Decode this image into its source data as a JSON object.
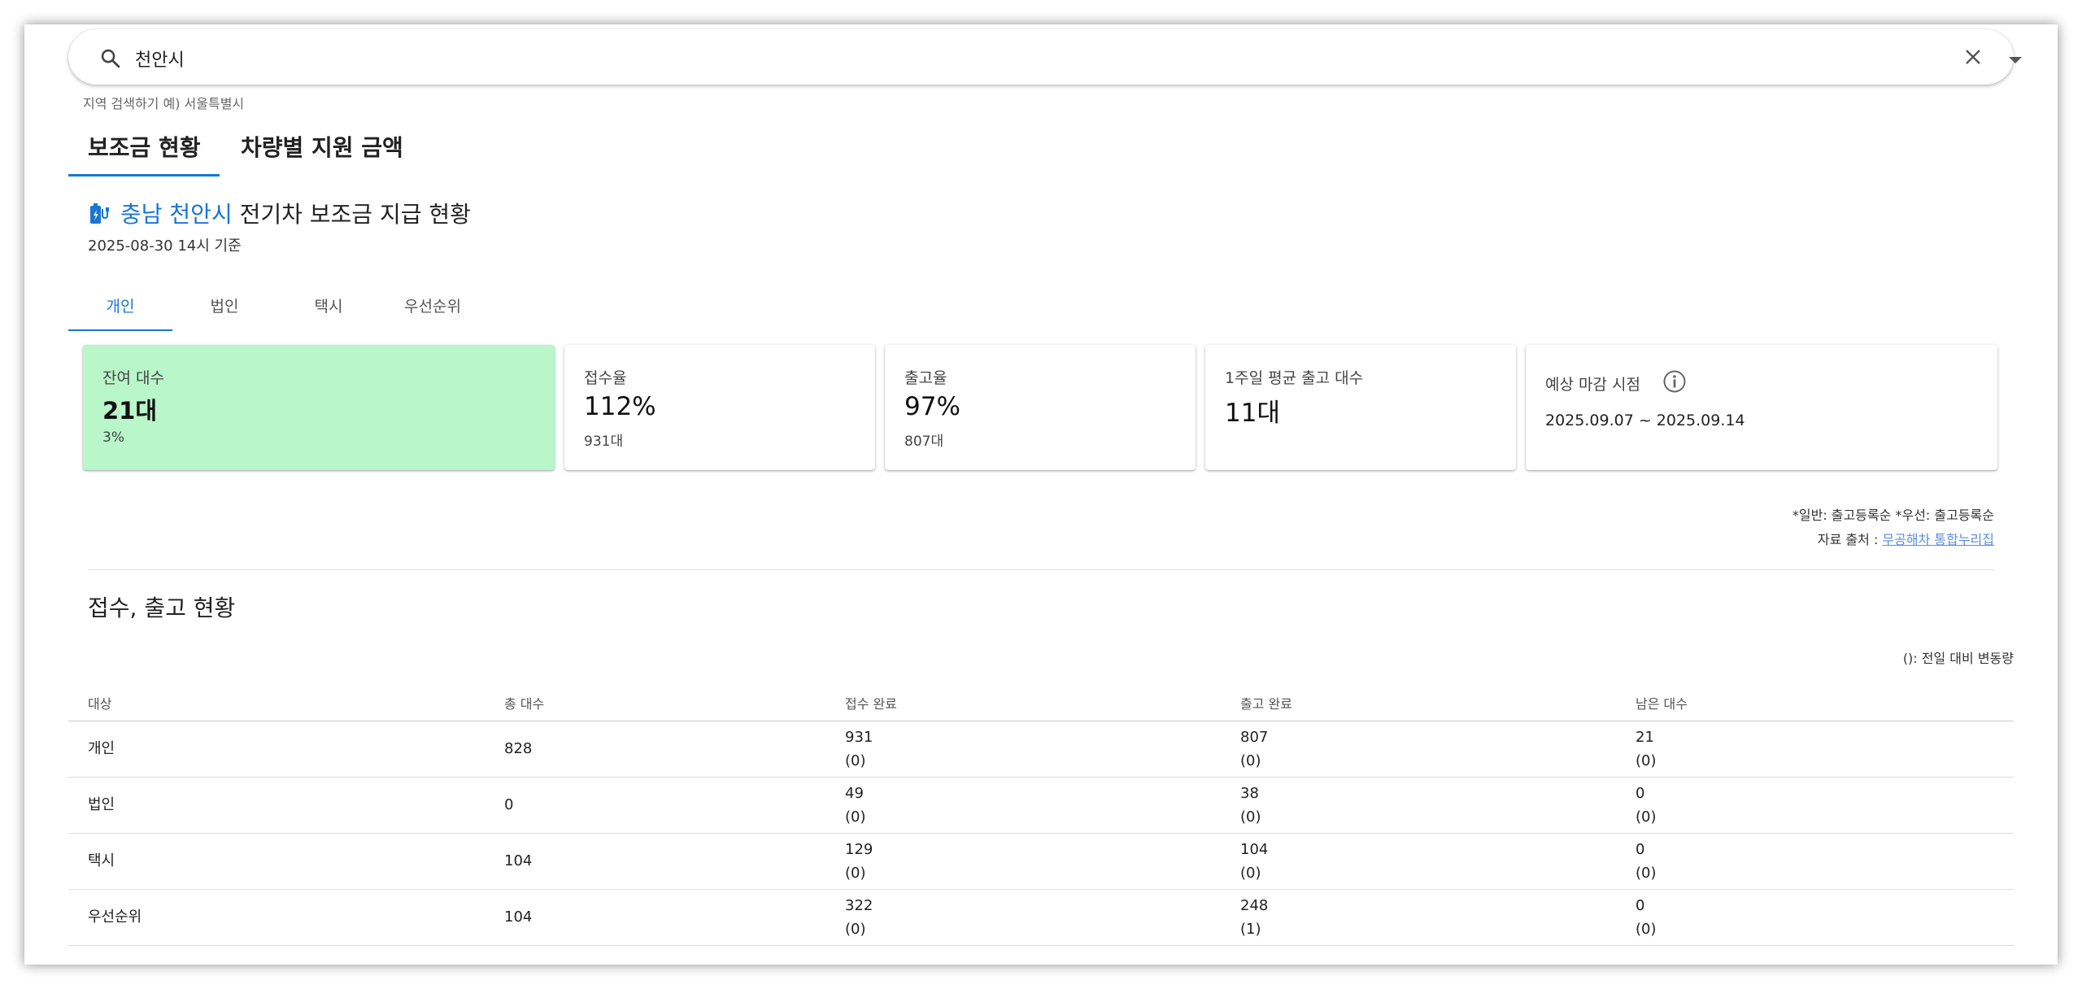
{
  "search": {
    "value": "천안시",
    "hint": "지역 검색하기 예) 서울특별시"
  },
  "main_tabs": [
    {
      "label": "보조금 현황"
    },
    {
      "label": "차량별 지원 금액"
    }
  ],
  "heading": {
    "region": "충남 천안시",
    "title": "전기차 보조금 지급 현황",
    "as_of": "2025-08-30 14시 기준"
  },
  "sub_tabs": [
    {
      "label": "개인"
    },
    {
      "label": "법인"
    },
    {
      "label": "택시"
    },
    {
      "label": "우선순위"
    }
  ],
  "cards": {
    "remaining": {
      "label": "잔여 대수",
      "value": "21대",
      "sub": "3%"
    },
    "reception_rate": {
      "label": "접수율",
      "value": "112%",
      "sub": "931대"
    },
    "release_rate": {
      "label": "출고율",
      "value": "97%",
      "sub": "807대"
    },
    "weekly_avg": {
      "label": "1주일 평균 출고 대수",
      "value": "11대"
    },
    "deadline": {
      "label": "예상 마감 시점",
      "period": "2025.09.07 ~ 2025.09.14"
    }
  },
  "notes": {
    "order": "*일반: 출고등록순 *우선: 출고등록순",
    "source_label": "자료 출처 : ",
    "source_link": "무공해차 통합누리집"
  },
  "status_section": {
    "title": "접수, 출고 현황",
    "legend": "(): 전일 대비 변동량",
    "columns": [
      "대상",
      "총 대수",
      "접수 완료",
      "출고 완료",
      "남은 대수"
    ],
    "rows": [
      {
        "target": "개인",
        "total": "828",
        "received": "931",
        "received_delta": "(0)",
        "released": "807",
        "released_delta": "(0)",
        "remaining": "21",
        "remaining_delta": "(0)"
      },
      {
        "target": "법인",
        "total": "0",
        "received": "49",
        "received_delta": "(0)",
        "released": "38",
        "released_delta": "(0)",
        "remaining": "0",
        "remaining_delta": "(0)"
      },
      {
        "target": "택시",
        "total": "104",
        "received": "129",
        "received_delta": "(0)",
        "released": "104",
        "released_delta": "(0)",
        "remaining": "0",
        "remaining_delta": "(0)"
      },
      {
        "target": "우선순위",
        "total": "104",
        "received": "322",
        "received_delta": "(0)",
        "released": "248",
        "released_delta": "(1)",
        "remaining": "0",
        "remaining_delta": "(0)"
      }
    ]
  },
  "colors": {
    "accent": "#1976d2",
    "highlight_card": "#b9f6ca",
    "link": "#5a8de0"
  }
}
